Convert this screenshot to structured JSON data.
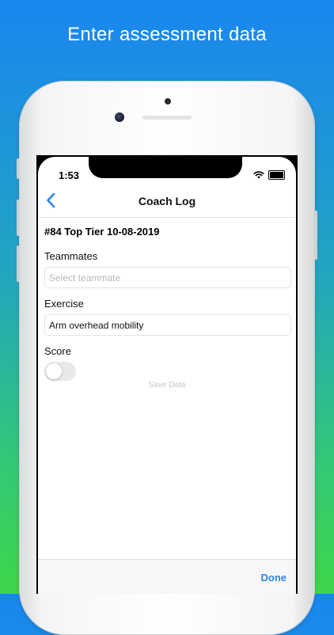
{
  "headline": "Enter assessment data",
  "status_bar": {
    "time": "1:53",
    "battery_level": 1.0
  },
  "nav": {
    "title": "Coach Log",
    "back_icon": "chevron-left-icon"
  },
  "form": {
    "record_title": "#84 Top Tier 10-08-2019",
    "teammates": {
      "label": "Teammates",
      "value": "",
      "placeholder": "Select teammate"
    },
    "exercise": {
      "label": "Exercise",
      "value": "Arm overhead mobility",
      "placeholder": ""
    },
    "score": {
      "label": "Score",
      "on": false
    },
    "save_label": "Save Data"
  },
  "toolbar": {
    "done_label": "Done"
  },
  "colors": {
    "accent": "#2f86e6",
    "background_top": "#1a86f0",
    "background_bottom": "#3fd64a"
  }
}
